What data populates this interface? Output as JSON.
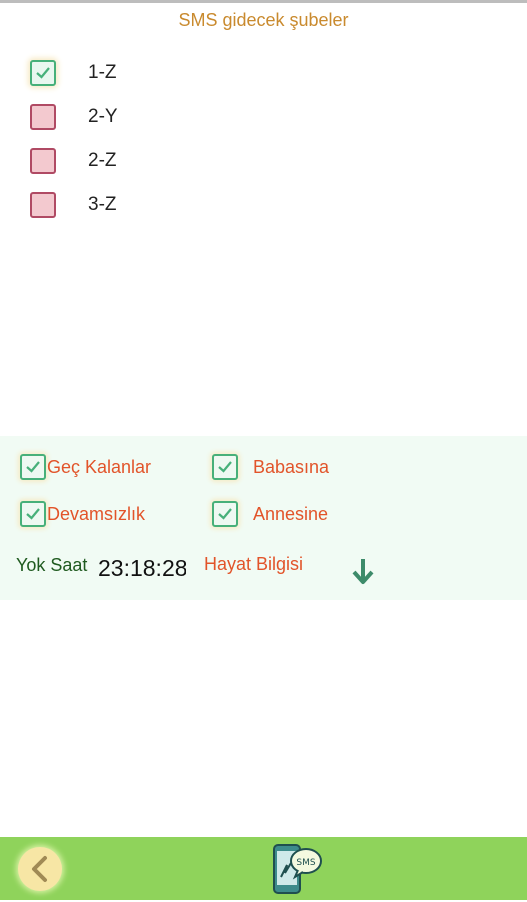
{
  "header": {
    "title": "SMS gidecek şubeler"
  },
  "branches": [
    {
      "label": "1-Z",
      "checked": true
    },
    {
      "label": "2-Y",
      "checked": false
    },
    {
      "label": "2-Z",
      "checked": false
    },
    {
      "label": "3-Z",
      "checked": false
    }
  ],
  "options": {
    "gec_kalanlar": {
      "label": "Geç Kalanlar",
      "checked": true
    },
    "devamsizlik": {
      "label": "Devamsızlık",
      "checked": true
    },
    "babasina": {
      "label": "Babasına",
      "checked": true
    },
    "annesine": {
      "label": "Annesine",
      "checked": true
    }
  },
  "yok_saat": {
    "label": "Yok Saat",
    "value": "23:18:28"
  },
  "hayat_bilgisi": {
    "label": "Hayat Bilgisi"
  },
  "icons": {
    "down": "arrow-down-icon",
    "back": "chevron-left-icon",
    "sms": "sms-phone-icon"
  },
  "colors": {
    "accent_green": "#47b07a",
    "bottom_bar": "#8fd35b",
    "option_text": "#e2542a"
  }
}
